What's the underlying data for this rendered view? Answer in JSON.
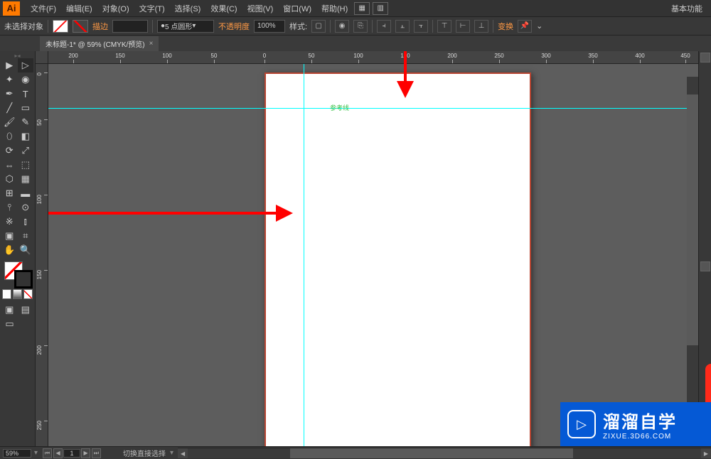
{
  "app": {
    "logo": "Ai"
  },
  "menu": {
    "file": "文件(F)",
    "edit": "编辑(E)",
    "object": "对象(O)",
    "type": "文字(T)",
    "select": "选择(S)",
    "effect": "效果(C)",
    "view": "视图(V)",
    "window": "窗口(W)",
    "help": "帮助(H)"
  },
  "workspace": {
    "label": "基本功能"
  },
  "options": {
    "no_selection": "未选择对象",
    "stroke_label": "描边",
    "stroke_value": "",
    "brush_value": "5 点圆形",
    "opacity_label": "不透明度",
    "opacity_value": "100%",
    "style_label": "样式:",
    "transform_label": "变换"
  },
  "document": {
    "tab_title": "未标题-1* @ 59% (CMYK/预览)",
    "zoom": "59%",
    "page": "1",
    "status_tool": "切换直接选择"
  },
  "guides": {
    "label": "参考线"
  },
  "ruler": {
    "h_ticks": [
      "200",
      "150",
      "100",
      "50",
      "0",
      "50",
      "100",
      "150",
      "200",
      "250",
      "300",
      "350",
      "400",
      "450"
    ],
    "h_positions": [
      35,
      101,
      167,
      233,
      304,
      370,
      436,
      502,
      568,
      634,
      700,
      766,
      832,
      896
    ],
    "v_ticks": [
      "0",
      "50",
      "100",
      "150",
      "200",
      "250"
    ],
    "v_positions": [
      12,
      78,
      184,
      290,
      396,
      502
    ]
  },
  "watermark": {
    "title": "溜溜自学",
    "url": "ZIXUE.3D66.COM"
  }
}
